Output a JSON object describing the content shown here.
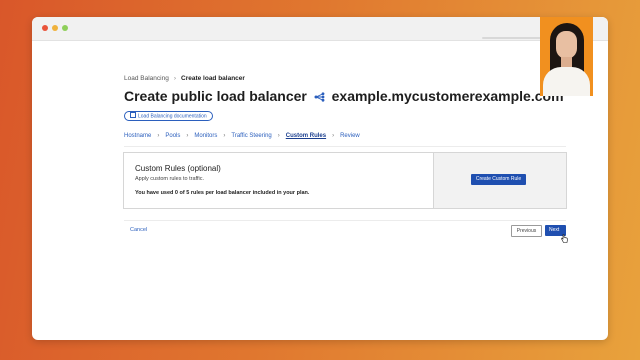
{
  "breadcrumb": {
    "parent": "Load Balancing",
    "current": "Create load balancer"
  },
  "page": {
    "title_prefix": "Create public load balancer",
    "domain": "example.mycustomerexample.com",
    "doc_link": "Load Balancing documentation"
  },
  "steps": [
    "Hostname",
    "Pools",
    "Monitors",
    "Traffic Steering",
    "Custom Rules",
    "Review"
  ],
  "active_step": "Custom Rules",
  "card": {
    "title": "Custom Rules (optional)",
    "subtitle": "Apply custom rules to traffic.",
    "usage": "You have used 0 of 5 rules per load balancer included in your plan.",
    "button": "Create Custom Rule"
  },
  "footer": {
    "cancel": "Cancel",
    "previous": "Previous",
    "next": "Next"
  },
  "colors": {
    "accent": "#1f4fb0",
    "link": "#2b5fbd",
    "background_start": "#d9572a",
    "background_end": "#e8a23c"
  }
}
